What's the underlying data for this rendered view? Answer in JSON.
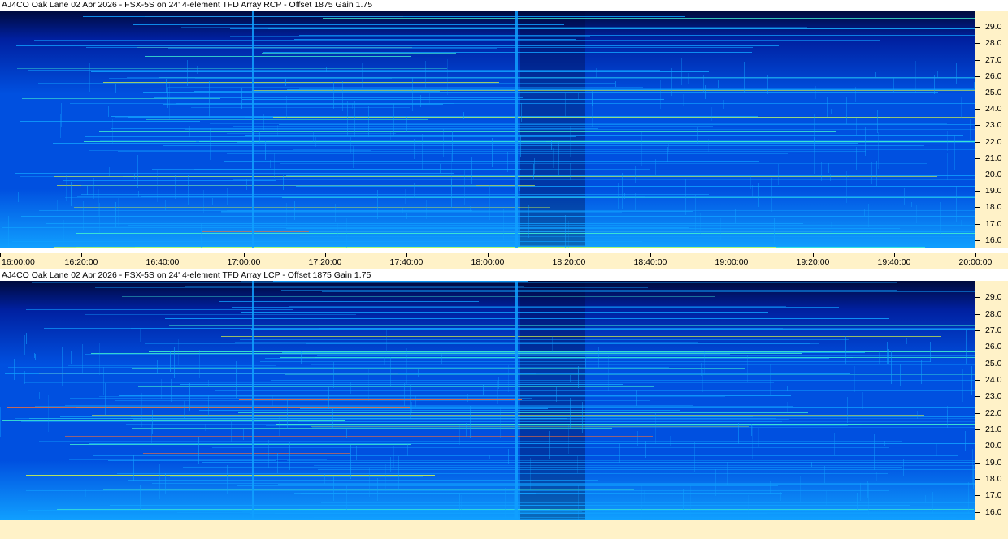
{
  "chart_data": [
    {
      "type": "heatmap",
      "title": "AJ4CO Oak Lane 02 Apr 2026 - FSX-5S on 24' 4-element TFD Array RCP  -  Offset 1875  Gain 1.75",
      "xlabel": "",
      "ylabel": "",
      "x_ticks": [
        "16:00:00",
        "16:20:00",
        "16:40:00",
        "17:00:00",
        "17:20:00",
        "17:40:00",
        "18:00:00",
        "18:20:00",
        "18:40:00",
        "19:00:00",
        "19:20:00",
        "19:40:00",
        "20:00:00"
      ],
      "x_range": [
        "16:00:00",
        "20:00:00"
      ],
      "y_ticks": [
        "29.0",
        "28.0",
        "27.0",
        "26.0",
        "25.0",
        "24.0",
        "23.0",
        "22.0",
        "21.0",
        "20.0",
        "19.0",
        "18.0",
        "17.0",
        "16.0"
      ],
      "y_range": [
        15.5,
        30.0
      ],
      "colormap": [
        "#000a3c",
        "#0020a0",
        "#0050e0",
        "#10a0ff",
        "#40f0d0",
        "#e0ff40",
        "#ff7030"
      ]
    },
    {
      "type": "heatmap",
      "title": "AJ4CO Oak Lane 02 Apr 2026 - FSX-5S on 24' 4-element TFD Array LCP  -  Offset 1875  Gain 1.75",
      "xlabel": "",
      "ylabel": "",
      "x_ticks": [],
      "x_range": [
        "16:00:00",
        "20:00:00"
      ],
      "y_ticks": [
        "29.0",
        "28.0",
        "27.0",
        "26.0",
        "25.0",
        "24.0",
        "23.0",
        "22.0",
        "21.0",
        "20.0",
        "19.0",
        "18.0",
        "17.0",
        "16.0"
      ],
      "y_range": [
        15.5,
        30.0
      ],
      "colormap": [
        "#000a3c",
        "#0020a0",
        "#0050e0",
        "#10a0ff",
        "#40f0d0",
        "#e0ff40",
        "#ff7030"
      ]
    }
  ]
}
